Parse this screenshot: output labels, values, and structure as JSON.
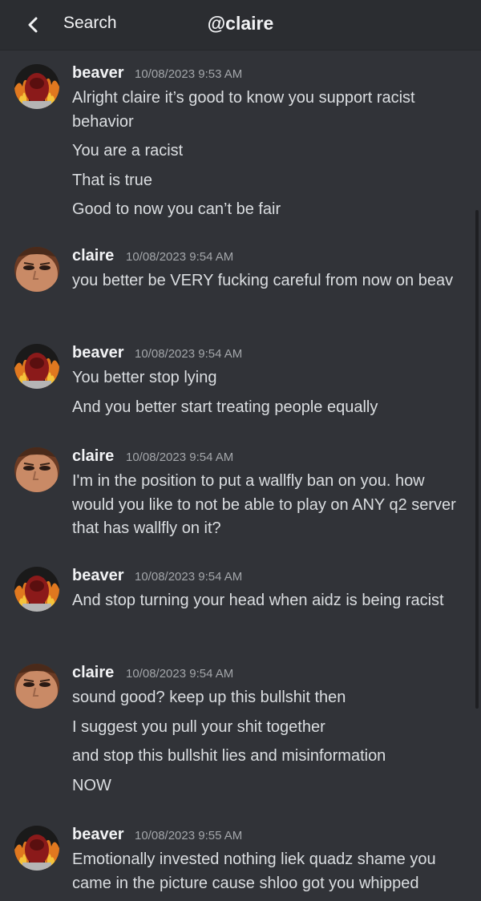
{
  "header": {
    "back_label": "Search",
    "title": "@claire"
  },
  "messages": [
    {
      "author": "beaver",
      "timestamp": "10/08/2023 9:53 AM",
      "avatar": "beaver-avatar",
      "lines": [
        "Alright claire it’s good to know you support racist behavior",
        "You are a racist",
        "That is true",
        "Good to now you can’t be fair"
      ]
    },
    {
      "author": "claire",
      "timestamp": "10/08/2023 9:54 AM",
      "avatar": "claire-avatar",
      "lines": [
        "you better be VERY fucking careful from now on beav"
      ]
    },
    {
      "author": "beaver",
      "timestamp": "10/08/2023 9:54 AM",
      "avatar": "beaver-avatar",
      "lines": [
        "You better stop lying",
        "And you better start treating people equally"
      ]
    },
    {
      "author": "claire",
      "timestamp": "10/08/2023 9:54 AM",
      "avatar": "claire-avatar",
      "lines": [
        "I'm in the position to put a wallfly ban on you. how would you like to not be able to play on ANY q2 server that has wallfly on it?"
      ]
    },
    {
      "author": "beaver",
      "timestamp": "10/08/2023 9:54 AM",
      "avatar": "beaver-avatar",
      "lines": [
        "And stop turning your head when aidz is being racist"
      ]
    },
    {
      "author": "claire",
      "timestamp": "10/08/2023 9:54 AM",
      "avatar": "claire-avatar",
      "lines": [
        "sound good? keep up this bullshit then",
        "I suggest you pull your shit together",
        "and stop this bullshit lies and misinformation",
        "NOW"
      ]
    },
    {
      "author": "beaver",
      "timestamp": "10/08/2023 9:55 AM",
      "avatar": "beaver-avatar",
      "lines": [
        "Emotionally invested nothing liek quadz shame you came in the picture cause shloo got you whipped"
      ]
    }
  ],
  "colors": {
    "background": "#313338",
    "header": "#2b2d31",
    "username": "#f2f3f5",
    "timestamp": "#a3a6aa",
    "text": "#dbdee1"
  }
}
